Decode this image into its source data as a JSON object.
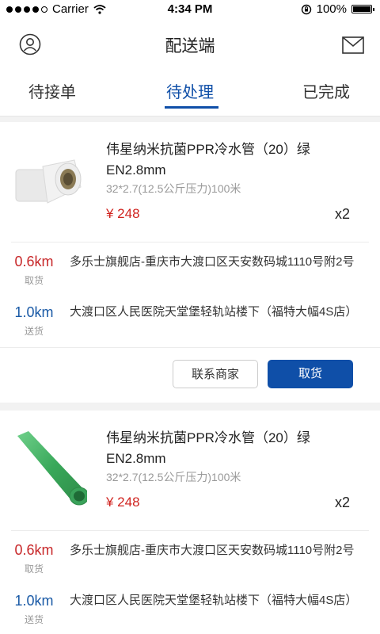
{
  "status_bar": {
    "carrier": "Carrier",
    "time": "4:34 PM",
    "battery": "100%"
  },
  "nav": {
    "title": "配送端"
  },
  "tabs": [
    {
      "label": "待接单",
      "active": false
    },
    {
      "label": "待处理",
      "active": true
    },
    {
      "label": "已完成",
      "active": false
    }
  ],
  "orders": [
    {
      "product_name": "伟星纳米抗菌PPR冷水管（20）绿EN2.8mm",
      "spec": "32*2.7(12.5公斤压力)100米",
      "price": "¥ 248",
      "qty": "x2",
      "pickup": {
        "distance": "0.6km",
        "label": "取货",
        "address": "多乐士旗舰店-重庆市大渡口区天安数码城1110号附2号"
      },
      "delivery": {
        "distance": "1.0km",
        "label": "送货",
        "address": "大渡口区人民医院天堂堡轻轨站楼下（福特大幅4S店）"
      },
      "contact_label": "联系商家",
      "pickup_button": "取货"
    },
    {
      "product_name": "伟星纳米抗菌PPR冷水管（20）绿EN2.8mm",
      "spec": "32*2.7(12.5公斤压力)100米",
      "price": "¥ 248",
      "qty": "x2",
      "pickup": {
        "distance": "0.6km",
        "label": "取货",
        "address": "多乐士旗舰店-重庆市大渡口区天安数码城1110号附2号"
      },
      "delivery": {
        "distance": "1.0km",
        "label": "送货",
        "address": "大渡口区人民医院天堂堡轻轨站楼下（福特大幅4S店）"
      }
    }
  ],
  "colors": {
    "accent": "#0f4fa8",
    "price": "#d0231f",
    "pickup_km": "#c8282a",
    "delivery_km": "#1a5aa6"
  },
  "icons": {
    "left": "user-icon",
    "right": "mail-icon"
  }
}
